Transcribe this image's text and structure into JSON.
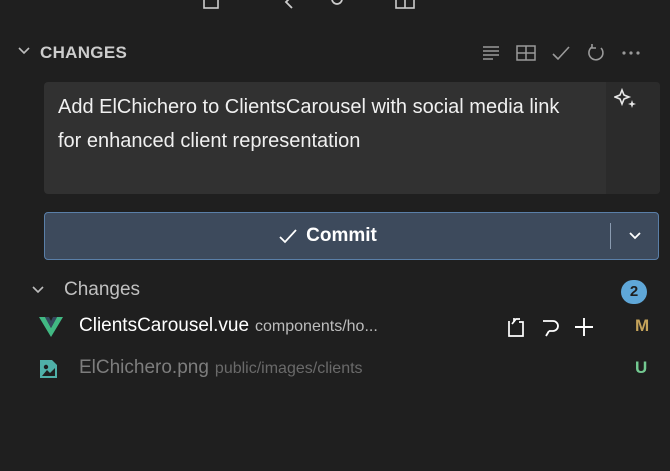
{
  "section": {
    "title": "CHANGES"
  },
  "commit_message": {
    "value": "Add ElChichero to ClientsCarousel with social media link for enhanced client representation"
  },
  "commit_button": {
    "label": "Commit"
  },
  "changes_group": {
    "label": "Changes",
    "count": "2"
  },
  "files": [
    {
      "name": "ClientsCarousel.vue",
      "path": "components/ho...",
      "status": "M",
      "icon": "vue-file-icon"
    },
    {
      "name": "ElChichero.png",
      "path": "public/images/clients",
      "status": "U",
      "icon": "image-file-icon"
    }
  ],
  "colors": {
    "accent": "#5fa7d8",
    "commit_bg": "#3d4a5c",
    "modified": "#c5a35a",
    "untracked": "#73c991",
    "vue_green": "#41b883"
  }
}
